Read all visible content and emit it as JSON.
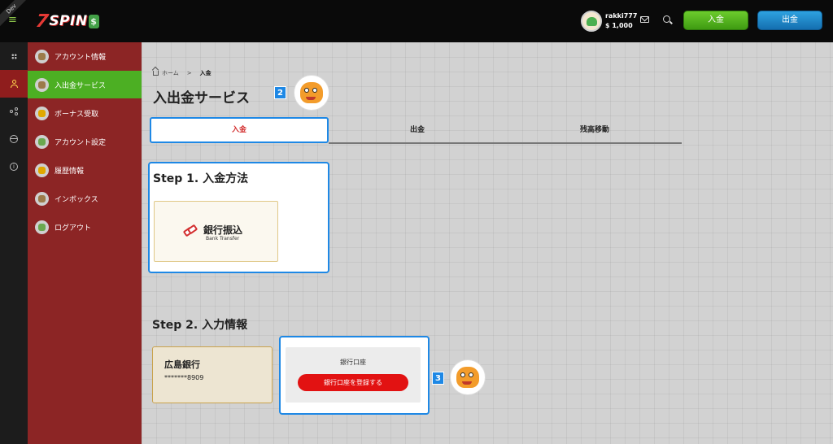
{
  "header": {
    "dev_label": "Dev",
    "logo": {
      "seven": "7",
      "spin": "SPIN",
      "coin": "$"
    },
    "user": {
      "name": "rakki777",
      "balance": "$ 1,000"
    },
    "deposit_label": "入金",
    "withdraw_label": "出金"
  },
  "rail": {
    "icons": [
      "dots-icon",
      "user-icon",
      "share-icon",
      "globe-icon",
      "info-icon"
    ]
  },
  "sidebar": {
    "items": [
      {
        "label": "アカウント情報"
      },
      {
        "label": "入出金サービス"
      },
      {
        "label": "ボーナス受取"
      },
      {
        "label": "アカウント設定"
      },
      {
        "label": "履歴情報"
      },
      {
        "label": "インボックス"
      },
      {
        "label": "ログアウト"
      }
    ],
    "active_index": 1
  },
  "main": {
    "breadcrumb": {
      "home": "ホーム",
      "separator": ">",
      "current": "入金"
    },
    "title": "入出金サービス",
    "badges": {
      "title_badge": "2",
      "account_badge": "3"
    },
    "tabs": [
      {
        "label": "入金"
      },
      {
        "label": "出金"
      },
      {
        "label": "残高移動"
      }
    ],
    "step1": {
      "title": "Step 1. 入金方法",
      "bank_jp": "銀行振込",
      "bank_en": "Bank Transfer"
    },
    "step2": {
      "title": "Step 2. 入力情報",
      "bank_name": "広島銀行",
      "account_masked": "*******8909",
      "account_label": "銀行口座",
      "register_label": "銀行口座を登録する"
    }
  },
  "colors": {
    "header_bg": "#0a0a0a",
    "sidebar_bg": "#8c2525",
    "sidebar_active": "#4caf23",
    "highlight_border": "#1e88e5",
    "deposit_green": "#4caf23",
    "withdraw_blue": "#1a80c4",
    "register_red": "#e21212"
  }
}
